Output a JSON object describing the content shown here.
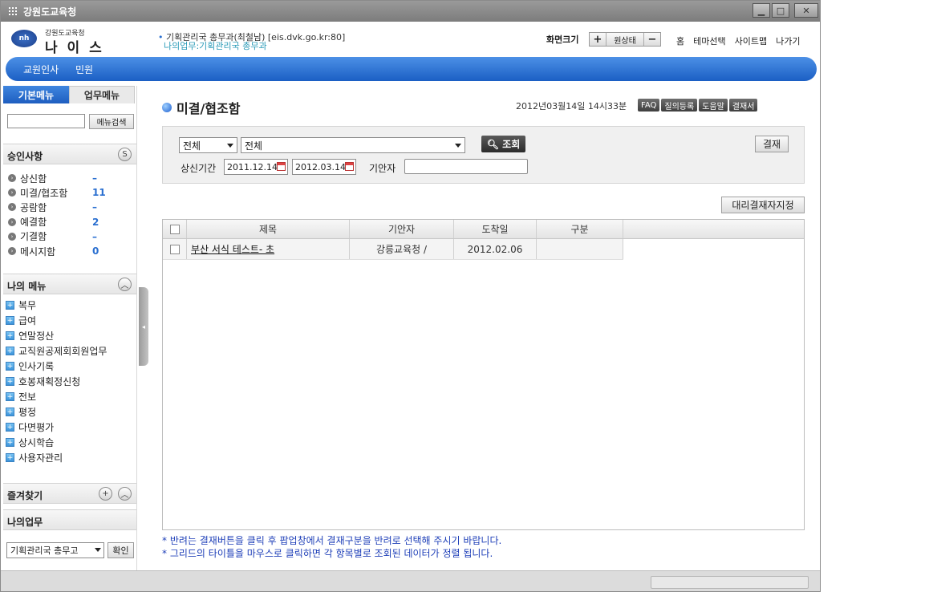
{
  "window": {
    "title": "강원도교육청"
  },
  "header": {
    "logo_sub": "강원도교육청",
    "logo_main": "나 이 스",
    "user_info": "기획관리국 총무과(최철남)  [eis.dvk.go.kr:80]",
    "user_link": "나의업무:기획관리국 총무과",
    "screen_size_label": "화면크기",
    "size_plus": "+",
    "size_orig": "원상태",
    "size_minus": "−",
    "links": [
      "홈",
      "테마선택",
      "사이트맵",
      "나가기"
    ]
  },
  "nav": {
    "items": [
      "교원인사",
      "민원"
    ]
  },
  "sidebar": {
    "tabs": [
      "기본메뉴",
      "업무메뉴"
    ],
    "search_button": "메뉴검색",
    "approval": {
      "title": "승인사항",
      "items": [
        {
          "label": "상신함",
          "count": "–"
        },
        {
          "label": "미결/협조함",
          "count": "11"
        },
        {
          "label": "공람함",
          "count": "–"
        },
        {
          "label": "예결함",
          "count": "2"
        },
        {
          "label": "기결함",
          "count": "–"
        },
        {
          "label": "메시지함",
          "count": "0"
        }
      ]
    },
    "my_menu": {
      "title": "나의 메뉴",
      "items": [
        "복무",
        "급여",
        "연말정산",
        "교직원공제회회원업무",
        "인사기록",
        "호봉재획정신청",
        "전보",
        "평정",
        "다면평가",
        "상시학습",
        "사용자관리"
      ]
    },
    "favorites_title": "즐겨찾기",
    "my_work": {
      "title": "나의업무",
      "select_value": "기획관리국 총무고",
      "confirm_button": "확인"
    }
  },
  "main": {
    "title": "미결/협조함",
    "datetime": "2012년03월14일 14시33분",
    "top_buttons": [
      "FAQ",
      "질의등록",
      "도움말",
      "결재서"
    ],
    "filter": {
      "select1": "전체",
      "select2": "전체",
      "search_button": "조회",
      "approve_button": "결재",
      "period_label": "상신기간",
      "date_from": "2011.12.14",
      "date_to": "2012.03.14",
      "drafter_label": "기안자",
      "drafter_value": ""
    },
    "proxy_button": "대리결재자지정",
    "table": {
      "columns": [
        "제목",
        "기안자",
        "도착일",
        "구분"
      ],
      "rows": [
        {
          "title": "부산 서식 테스트- 초",
          "drafter": "강릉교육청 /",
          "arrival": "2012.02.06",
          "category": ""
        }
      ]
    },
    "notes": [
      "* 반려는 결재버튼을 클릭 후 팝업창에서 결재구분을 반려로 선택해 주시기 바랍니다.",
      "* 그리드의 타이틀을 마우스로 클릭하면 각 항목별로 조회된 데이터가 정렬 됩니다."
    ]
  },
  "colors": {
    "nav_blue": "#1b5fc4",
    "count_blue": "#2a6fd0",
    "note_blue": "#1e3fb8"
  }
}
